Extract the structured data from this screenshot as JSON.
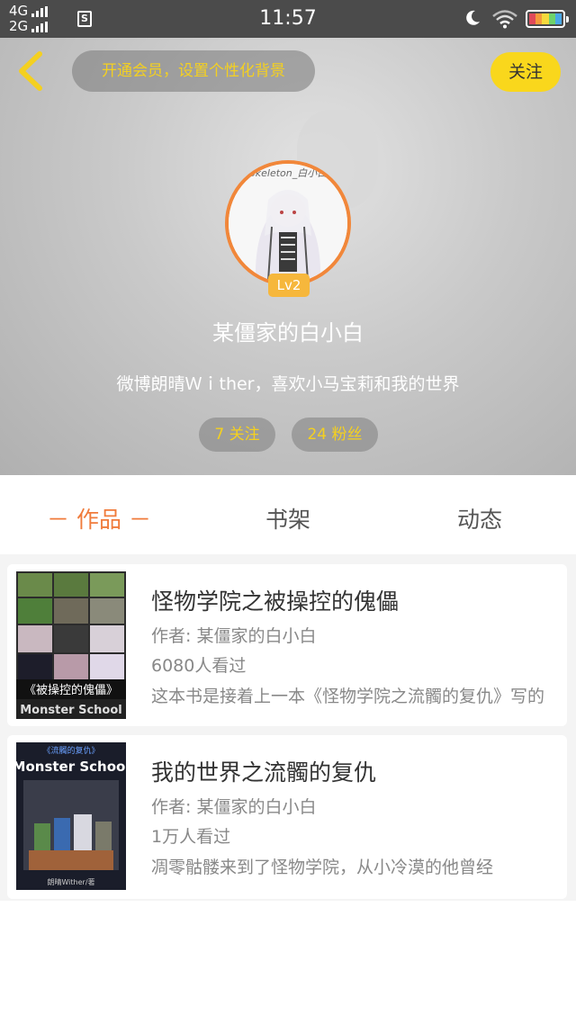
{
  "status_bar": {
    "net1": "4G",
    "net2": "2G",
    "sim_label": "S",
    "time": "11:57",
    "icons": [
      "moon-icon",
      "wifi-icon",
      "battery-icon"
    ]
  },
  "header": {
    "vip_text": "开通会员，设置个性化背景",
    "follow_label": "关注",
    "avatar_caption": "Skeleton_白小白",
    "level": "Lv2",
    "username": "某僵家的白小白",
    "bio": "微博朗晴Ｗｉther，喜欢小马宝莉和我的世界",
    "following": "7 关注",
    "fans": "24 粉丝"
  },
  "tabs": {
    "works": "－ 作品 －",
    "shelf": "书架",
    "feed": "动态"
  },
  "books": [
    {
      "title": "怪物学院之被操控的傀儡",
      "author": "作者: 某僵家的白小白",
      "views": "6080人看过",
      "desc": "这本书是接着上一本《怪物学院之流髑的复仇》写的",
      "cover_title": "《被操控的傀儡》",
      "cover_subtitle": "Monster School"
    },
    {
      "title": "我的世界之流髑的复仇",
      "author": "作者: 某僵家的白小白",
      "views": "1万人看过",
      "desc": "凋零骷髅来到了怪物学院，从小冷漠的他曾经",
      "cover_top": "《流髑的复仇》",
      "cover_title": "Monster School",
      "cover_credit": "朗晴Wither/著"
    }
  ],
  "colors": {
    "accent": "#f07b3b",
    "yellow": "#f9d71c",
    "status_bg": "#4b4b4b"
  }
}
